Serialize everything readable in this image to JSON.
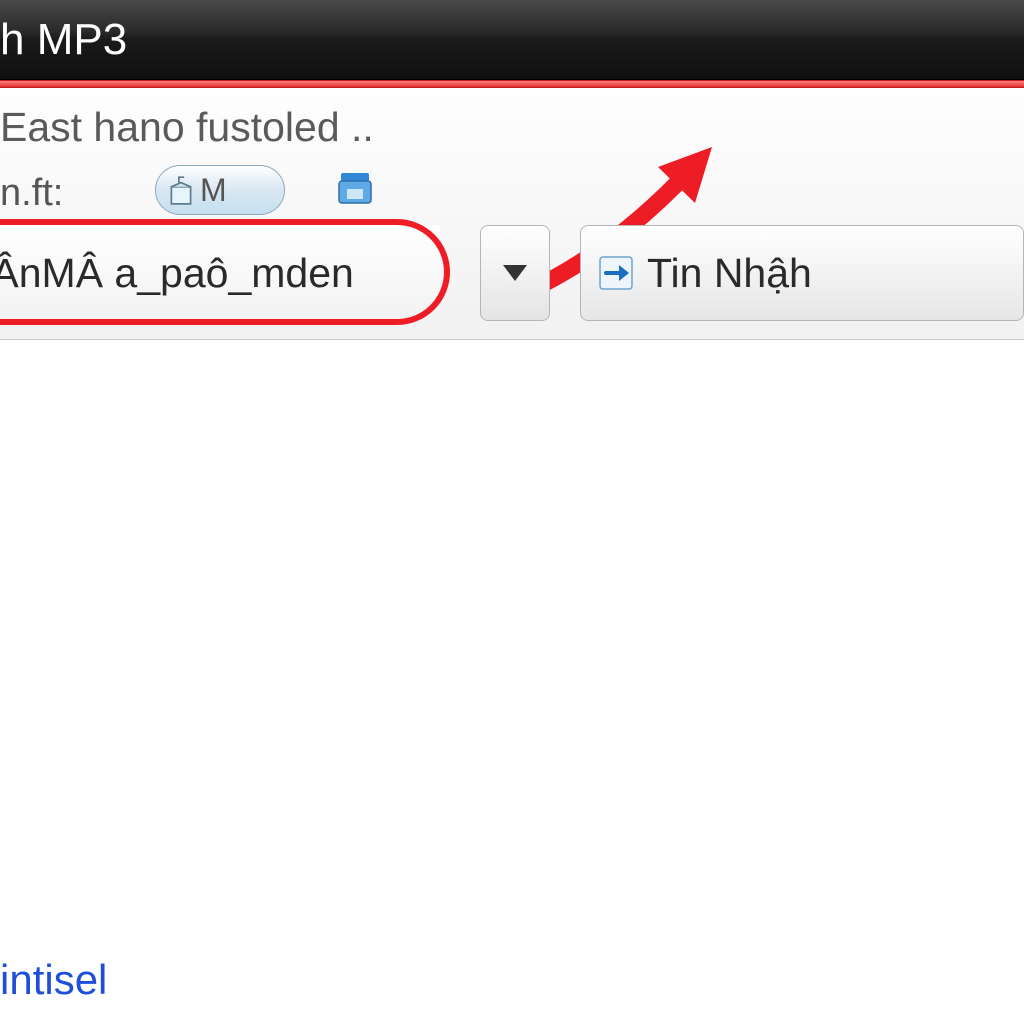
{
  "title": "h MP3",
  "breadcrumb": "East hano fustoled  ..",
  "row2": {
    "nft_label": "n.ft:",
    "pill_label": " M"
  },
  "filename": {
    "value": "IÂnMÂ a_paô_mden"
  },
  "action_button": {
    "label": "Tin Nhậh"
  },
  "link_text": "intisel",
  "colors": {
    "highlight": "#ee1c25",
    "link": "#1f4fd8"
  }
}
